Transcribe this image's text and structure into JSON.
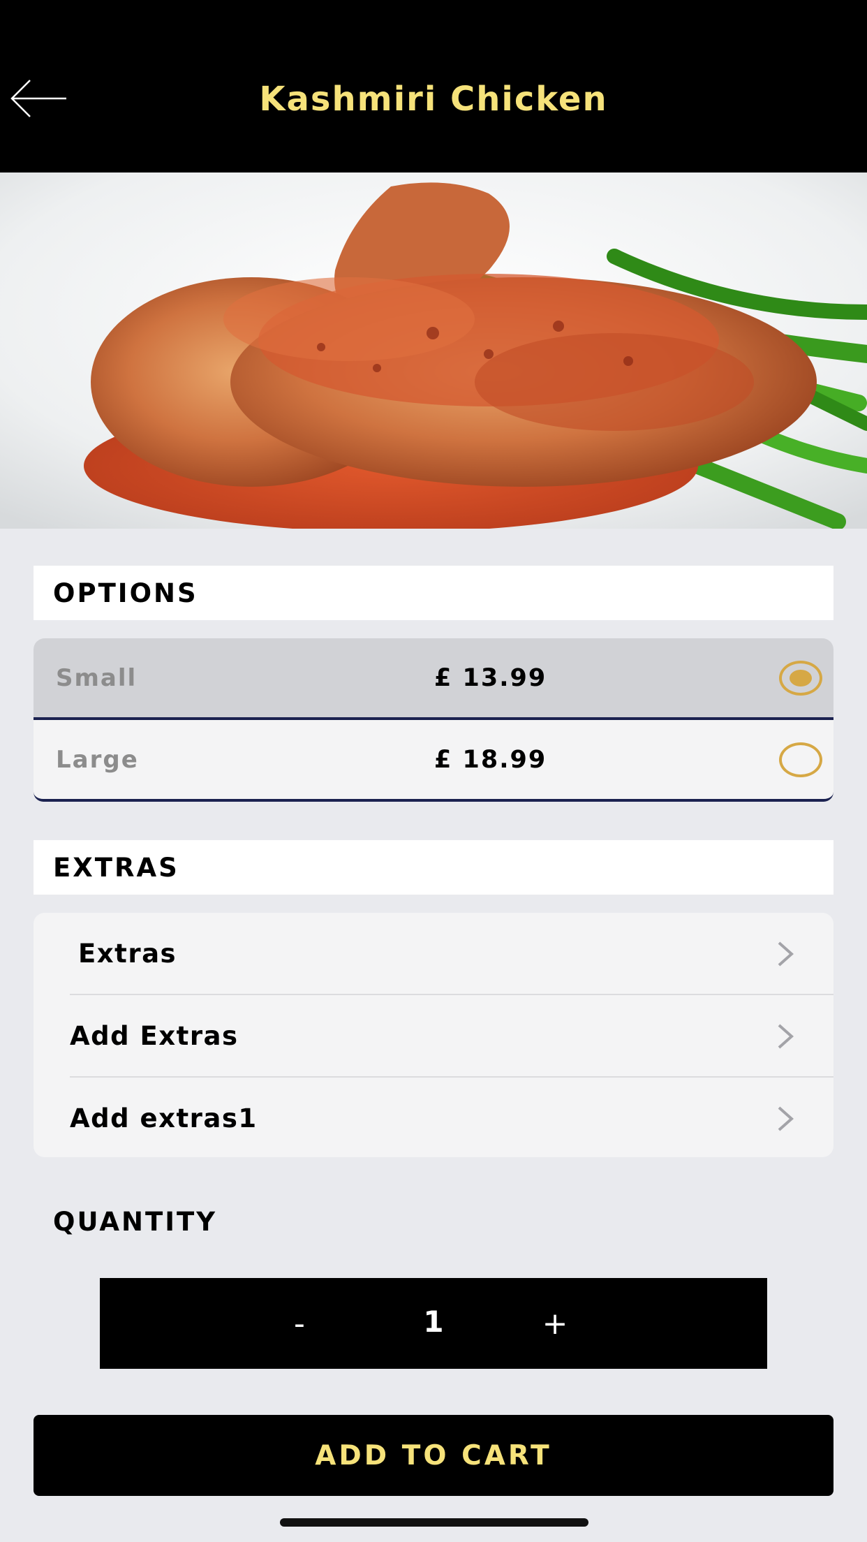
{
  "header": {
    "title": "Kashmiri Chicken",
    "back_icon": "arrow-left-icon",
    "title_color": "#f6e27a"
  },
  "hero_image": {
    "subject": "chicken-with-green-beans"
  },
  "options": {
    "heading": "OPTIONS",
    "items": [
      {
        "name": "Small",
        "price": "£ 13.99",
        "selected": true
      },
      {
        "name": "Large",
        "price": "£ 18.99",
        "selected": false
      }
    ],
    "radio_color": "#d6a845"
  },
  "extras": {
    "heading": "EXTRAS",
    "items": [
      {
        "label": "Extras"
      },
      {
        "label": "Add Extras"
      },
      {
        "label": "Add extras1"
      }
    ]
  },
  "quantity": {
    "heading": "QUANTITY",
    "minus": "-",
    "value": "1",
    "plus": "+"
  },
  "cart": {
    "label": "ADD TO CART"
  }
}
